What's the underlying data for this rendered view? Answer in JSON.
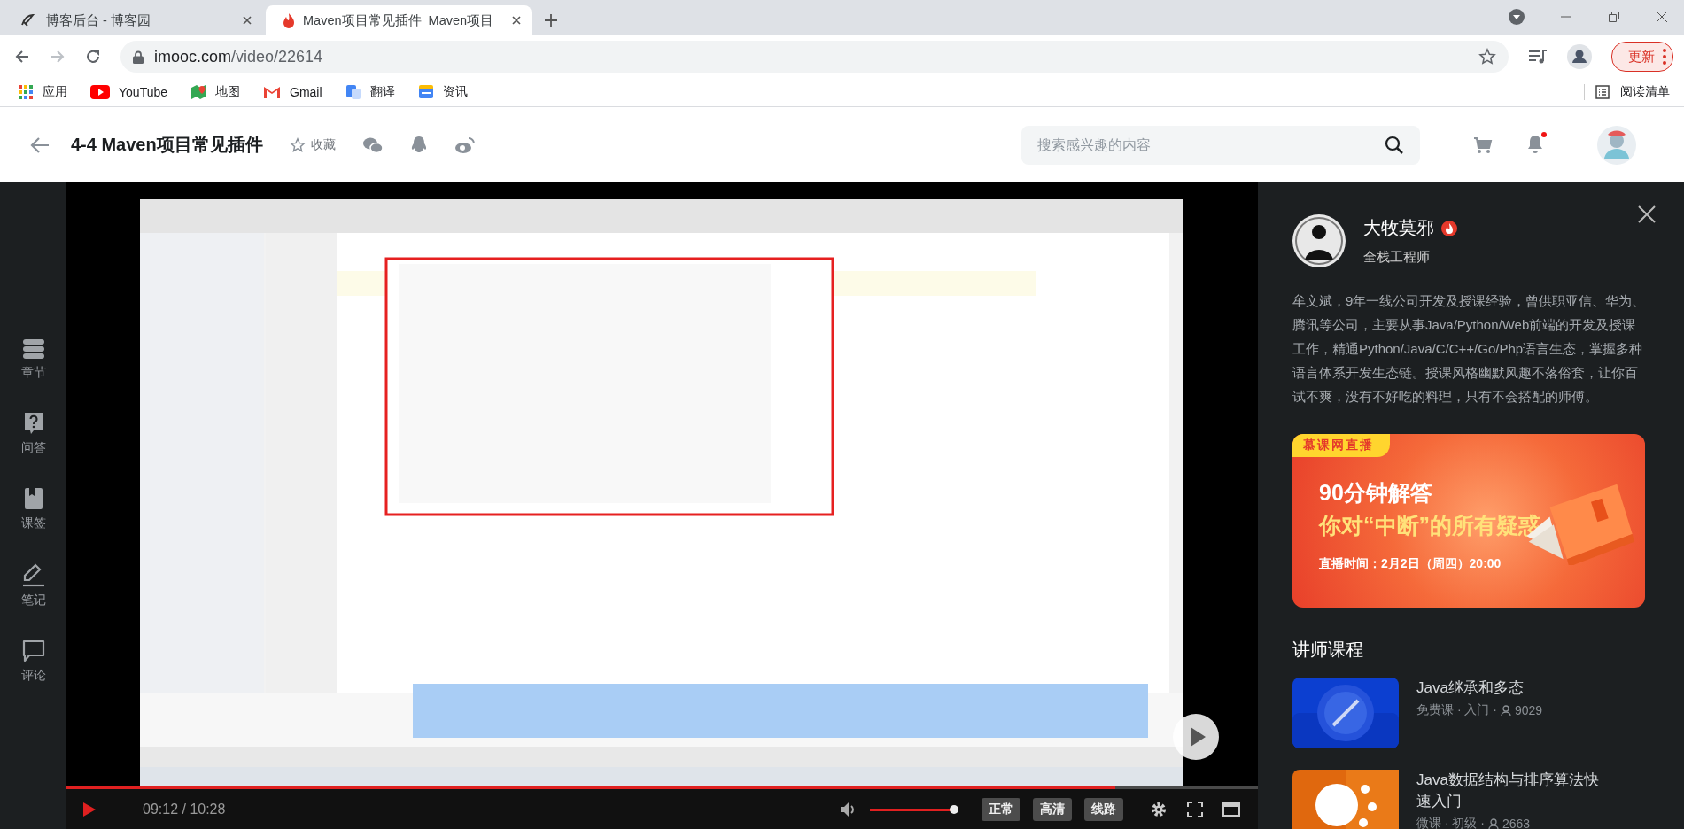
{
  "browser": {
    "tabs": [
      {
        "title": "博客后台 - 博客园",
        "selected": false
      },
      {
        "title": "Maven项目常见插件_Maven项目",
        "selected": true
      }
    ],
    "nav": {
      "forward_disabled": true
    },
    "address": {
      "host": "imooc.com",
      "path": "/video/22614"
    },
    "update_button": "更新",
    "bookmarks": [
      "应用",
      "YouTube",
      "地图",
      "Gmail",
      "翻译",
      "资讯"
    ],
    "reading_list": "阅读清单"
  },
  "header": {
    "title": "4-4 Maven项目常见插件",
    "favorite": "收藏",
    "search": {
      "placeholder": "搜索感兴趣的内容"
    },
    "notification_dot": true
  },
  "side_nav": [
    {
      "label": "章节"
    },
    {
      "label": "问答"
    },
    {
      "label": "课签"
    },
    {
      "label": "笔记"
    },
    {
      "label": "评论"
    }
  ],
  "player": {
    "time": "09:12 / 10:28",
    "progress": {
      "level": 0.88
    },
    "volume": {
      "level": 0.95
    },
    "buttons": [
      "正常",
      "高清",
      "线路"
    ]
  },
  "teacher": {
    "name": "大牧莫邪",
    "title": "全栈工程师",
    "bio": "牟文斌，9年一线公司开发及授课经验，曾供职亚信、华为、腾讯等公司，主要从事Java/Python/Web前端的开发及授课工作，精通Python/Java/C/C++/Go/Php语言生态，掌握多种语言体系开发生态链。授课风格幽默风趣不落俗套，让你百试不爽，没有不好吃的料理，只有不会搭配的师傅。"
  },
  "banner": {
    "tag": "慕课网直播",
    "headline": "90分钟解答",
    "subline": "你对“中断”的所有疑惑",
    "time": "直播时间：2月2日（周四）20:00"
  },
  "courses_heading": "讲师课程",
  "courses": [
    {
      "title": "Java继承和多态",
      "meta": "免费课 · 入门 ·",
      "students": "9029"
    },
    {
      "title": "Java数据结构与排序算法快速入门",
      "meta": "微课 · 初级 ·",
      "students": "2663"
    }
  ]
}
